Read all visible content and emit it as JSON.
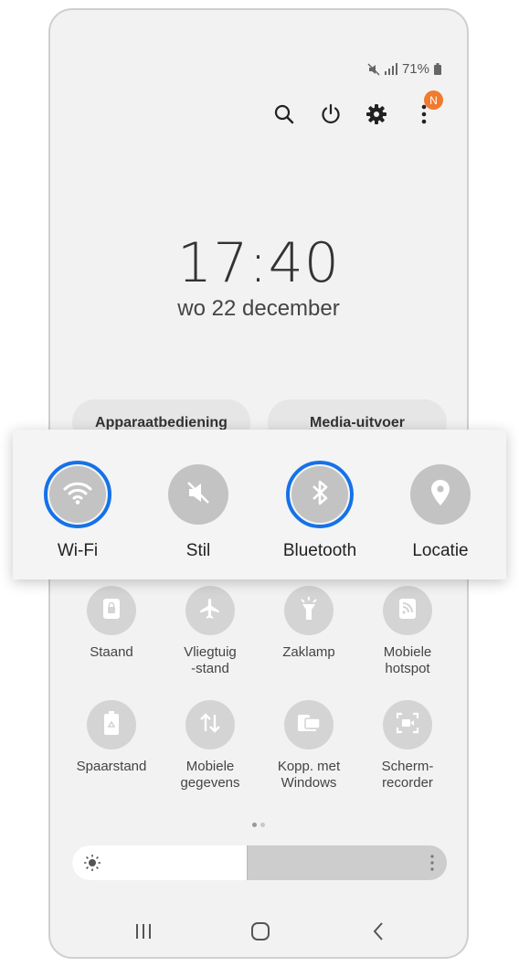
{
  "status_bar": {
    "battery": "71%"
  },
  "notification_badge": "N",
  "lockscreen": {
    "time": "17:40",
    "date": "wo 22 december"
  },
  "panel_buttons": {
    "device_control": "Apparaatbediening",
    "media_output": "Media-uitvoer"
  },
  "quick_toggles": [
    {
      "label": "Wi-Fi",
      "icon": "wifi-icon",
      "active": true
    },
    {
      "label": "Stil",
      "icon": "mute-icon",
      "active": false
    },
    {
      "label": "Bluetooth",
      "icon": "bluetooth-icon",
      "active": true
    },
    {
      "label": "Locatie",
      "icon": "location-icon",
      "active": false
    }
  ],
  "tiles_row1": [
    {
      "label": "Staand",
      "icon": "portrait-lock-icon"
    },
    {
      "label": "Vliegtuig\n-stand",
      "icon": "airplane-icon"
    },
    {
      "label": "Zaklamp",
      "icon": "flashlight-icon"
    },
    {
      "label": "Mobiele\nhotspot",
      "icon": "hotspot-icon"
    }
  ],
  "tiles_row2": [
    {
      "label": "Spaarstand",
      "icon": "power-saving-icon"
    },
    {
      "label": "Mobiele\ngegevens",
      "icon": "mobile-data-icon"
    },
    {
      "label": "Kopp. met\nWindows",
      "icon": "link-to-windows-icon"
    },
    {
      "label": "Scherm-\nrecorder",
      "icon": "screen-recorder-icon"
    }
  ],
  "brightness_level": 0.465,
  "colors": {
    "accent": "#1572e8",
    "badge": "#f07a2e"
  }
}
